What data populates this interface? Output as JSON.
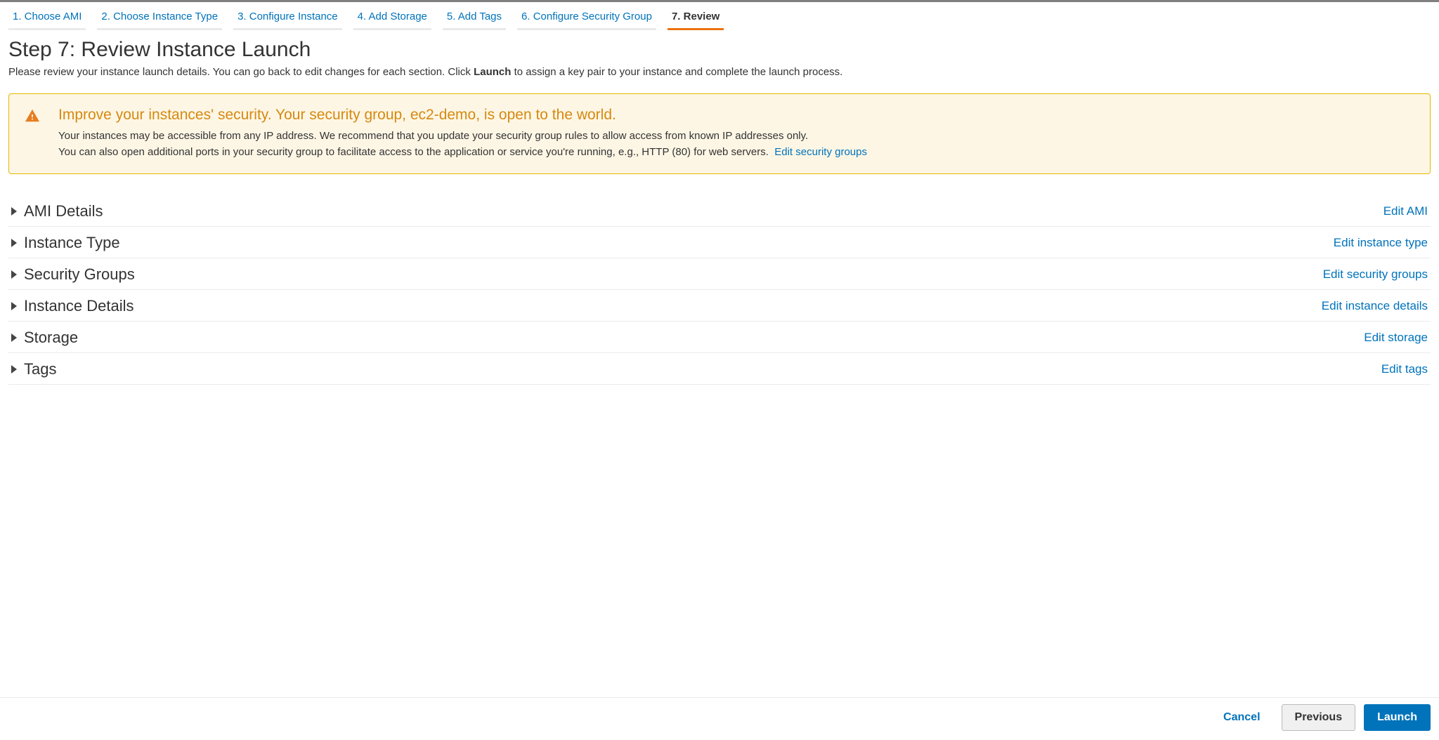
{
  "wizard": {
    "steps": [
      {
        "label": "1. Choose AMI"
      },
      {
        "label": "2. Choose Instance Type"
      },
      {
        "label": "3. Configure Instance"
      },
      {
        "label": "4. Add Storage"
      },
      {
        "label": "5. Add Tags"
      },
      {
        "label": "6. Configure Security Group"
      },
      {
        "label": "7. Review"
      }
    ]
  },
  "page": {
    "title": "Step 7: Review Instance Launch",
    "subtitle_prefix": "Please review your instance launch details. You can go back to edit changes for each section. Click ",
    "subtitle_bold": "Launch",
    "subtitle_suffix": " to assign a key pair to your instance and complete the launch process."
  },
  "warning": {
    "title": "Improve your instances' security. Your security group, ec2-demo, is open to the world.",
    "line1": "Your instances may be accessible from any IP address. We recommend that you update your security group rules to allow access from known IP addresses only.",
    "line2": "You can also open additional ports in your security group to facilitate access to the application or service you're running, e.g., HTTP (80) for web servers.",
    "link": "Edit security groups"
  },
  "sections": [
    {
      "title": "AMI Details",
      "edit": "Edit AMI"
    },
    {
      "title": "Instance Type",
      "edit": "Edit instance type"
    },
    {
      "title": "Security Groups",
      "edit": "Edit security groups"
    },
    {
      "title": "Instance Details",
      "edit": "Edit instance details"
    },
    {
      "title": "Storage",
      "edit": "Edit storage"
    },
    {
      "title": "Tags",
      "edit": "Edit tags"
    }
  ],
  "footer": {
    "cancel": "Cancel",
    "previous": "Previous",
    "launch": "Launch"
  }
}
